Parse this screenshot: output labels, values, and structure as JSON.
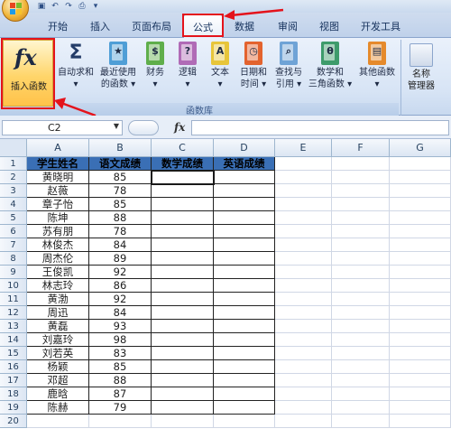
{
  "tabs": [
    "开始",
    "插入",
    "页面布局",
    "公式",
    "数据",
    "审阅",
    "视图",
    "开发工具"
  ],
  "active_tab": "公式",
  "ribbon": {
    "insert_function": "插入函数",
    "autosum": [
      "自动求和",
      "▾"
    ],
    "recent": [
      "最近使用",
      "的函数 ▾"
    ],
    "financial": [
      "财务",
      "▾"
    ],
    "logical": [
      "逻辑",
      "▾"
    ],
    "text": [
      "文本",
      "▾"
    ],
    "datetime": [
      "日期和",
      "时间 ▾"
    ],
    "lookup": [
      "查找与",
      "引用 ▾"
    ],
    "math": [
      "数学和",
      "三角函数 ▾"
    ],
    "other": [
      "其他函数",
      "▾"
    ],
    "name_manager": [
      "名称",
      "管理器"
    ],
    "group_label": "函数库"
  },
  "formula_bar": {
    "name_box": "C2",
    "fx": "fx",
    "content": ""
  },
  "columns": [
    "A",
    "B",
    "C",
    "D",
    "E",
    "F",
    "G"
  ],
  "rows": [
    [
      "学生姓名",
      "语文成绩",
      "数学成绩",
      "英语成绩"
    ],
    [
      "黄晓明",
      "85",
      "",
      ""
    ],
    [
      "赵薇",
      "78",
      "",
      ""
    ],
    [
      "章子怡",
      "85",
      "",
      ""
    ],
    [
      "陈坤",
      "88",
      "",
      ""
    ],
    [
      "苏有朋",
      "78",
      "",
      ""
    ],
    [
      "林俊杰",
      "84",
      "",
      ""
    ],
    [
      "周杰伦",
      "89",
      "",
      ""
    ],
    [
      "王俊凯",
      "92",
      "",
      ""
    ],
    [
      "林志玲",
      "86",
      "",
      ""
    ],
    [
      "黄渤",
      "92",
      "",
      ""
    ],
    [
      "周迅",
      "84",
      "",
      ""
    ],
    [
      "黄磊",
      "93",
      "",
      ""
    ],
    [
      "刘嘉玲",
      "98",
      "",
      ""
    ],
    [
      "刘若英",
      "83",
      "",
      ""
    ],
    [
      "杨颖",
      "85",
      "",
      ""
    ],
    [
      "邓超",
      "88",
      "",
      ""
    ],
    [
      "鹿晗",
      "87",
      "",
      ""
    ],
    [
      "陈赫",
      "79",
      "",
      ""
    ],
    [
      "",
      "",
      "",
      ""
    ]
  ],
  "colors": {
    "header_fill": "#3a6fb5",
    "highlight_red": "#e4131b"
  }
}
